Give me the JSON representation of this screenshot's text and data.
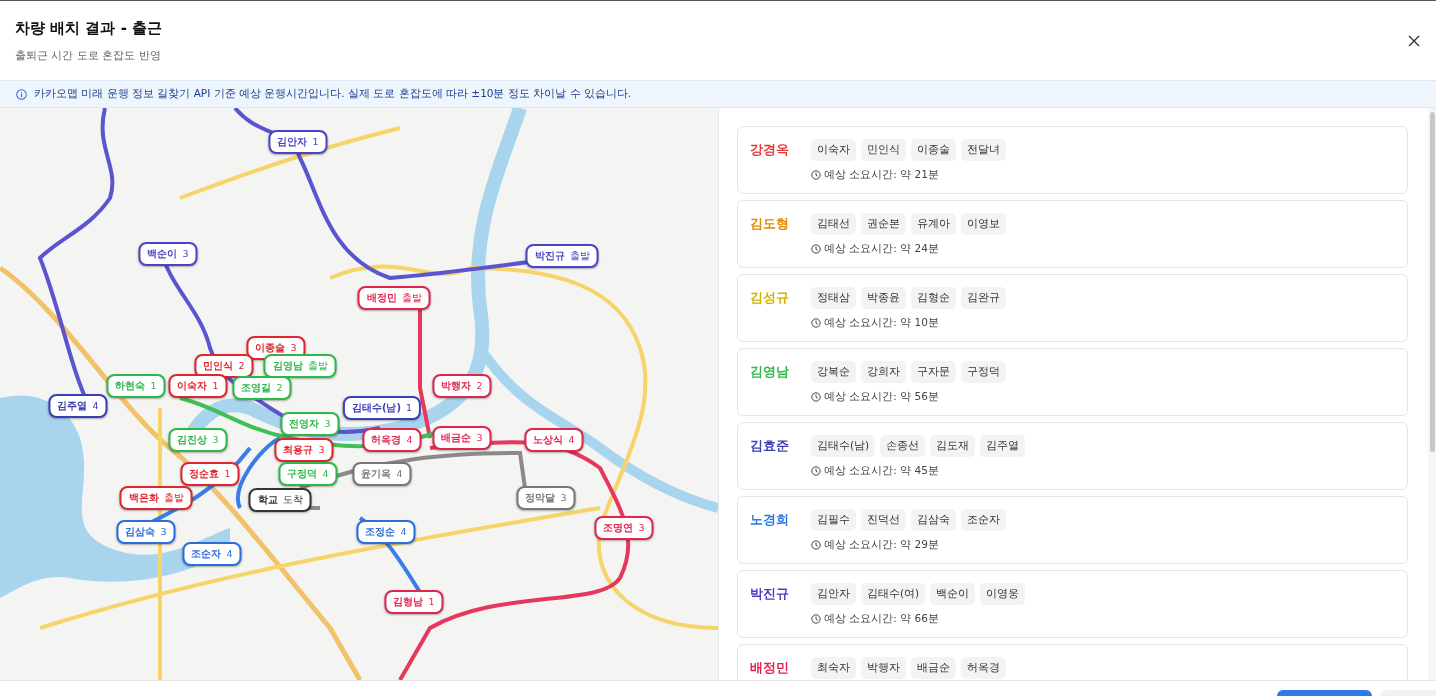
{
  "dialog": {
    "title": "차량 배치 결과 - 출근",
    "subtitle": "출퇴근 시간 도로 혼잡도 반영"
  },
  "notice": "카카오맵 미래 운행 정보 길찾기 API 기준 예상 운행시간입니다. 실제 도로 혼잡도에 따라 ±10분 정도 차이날 수 있습니다.",
  "map": {
    "markers": [
      {
        "name": "김안자",
        "tag": "1",
        "color": "#4b45c6"
      },
      {
        "name": "백순이",
        "tag": "3",
        "color": "#4b45c6"
      },
      {
        "name": "박진규",
        "tag": "출발",
        "color": "#4b45c6"
      },
      {
        "name": "배정민",
        "tag": "출발",
        "color": "#e0264f"
      },
      {
        "name": "이종술",
        "tag": "3",
        "color": "#e0262e"
      },
      {
        "name": "민인식",
        "tag": "2",
        "color": "#e0262e"
      },
      {
        "name": "김영남",
        "tag": "출발",
        "color": "#2fb84a"
      },
      {
        "name": "하현숙",
        "tag": "1",
        "color": "#2fb84a"
      },
      {
        "name": "이숙자",
        "tag": "1",
        "color": "#e0262e"
      },
      {
        "name": "조영길",
        "tag": "2",
        "color": "#2fb84a"
      },
      {
        "name": "박행자",
        "tag": "2",
        "color": "#e0264f"
      },
      {
        "name": "김주열",
        "tag": "4",
        "color": "#3b3fb5"
      },
      {
        "name": "김태수(남)",
        "tag": "1",
        "color": "#3b3fb5"
      },
      {
        "name": "전영자",
        "tag": "3",
        "color": "#2fb84a"
      },
      {
        "name": "김진상",
        "tag": "3",
        "color": "#2fb84a"
      },
      {
        "name": "허옥경",
        "tag": "4",
        "color": "#e0264f"
      },
      {
        "name": "배금순",
        "tag": "3",
        "color": "#e0264f"
      },
      {
        "name": "노상식",
        "tag": "4",
        "color": "#e0264f"
      },
      {
        "name": "최용규",
        "tag": "3",
        "color": "#e0262e"
      },
      {
        "name": "정순효",
        "tag": "1",
        "color": "#e0262e"
      },
      {
        "name": "구정덕",
        "tag": "4",
        "color": "#2fb84a"
      },
      {
        "name": "윤기옥",
        "tag": "4",
        "color": "#777777"
      },
      {
        "name": "백은화",
        "tag": "출발",
        "color": "#e0262e"
      },
      {
        "name": "학교",
        "tag": "도착",
        "color": "#333333"
      },
      {
        "name": "정막달",
        "tag": "3",
        "color": "#777777"
      },
      {
        "name": "김삼숙",
        "tag": "3",
        "color": "#2a6fdb"
      },
      {
        "name": "조정순",
        "tag": "4",
        "color": "#2a6fdb"
      },
      {
        "name": "조명연",
        "tag": "3",
        "color": "#e0264f"
      },
      {
        "name": "조순자",
        "tag": "4",
        "color": "#2a6fdb"
      },
      {
        "name": "김형남",
        "tag": "1",
        "color": "#e0264f"
      }
    ]
  },
  "drivers": [
    {
      "name": "강경옥",
      "color": "#e53935",
      "passengers": [
        "이숙자",
        "민인식",
        "이종술",
        "전달녀"
      ],
      "time": "예상 소요시간: 약 21분"
    },
    {
      "name": "김도형",
      "color": "#e08a00",
      "passengers": [
        "김태선",
        "권순본",
        "유계아",
        "이영보"
      ],
      "time": "예상 소요시간: 약 24분"
    },
    {
      "name": "김성규",
      "color": "#d4b000",
      "passengers": [
        "정태삼",
        "박종윤",
        "김형순",
        "김완규"
      ],
      "time": "예상 소요시간: 약 10분"
    },
    {
      "name": "김영남",
      "color": "#2fb84a",
      "passengers": [
        "강복순",
        "강희자",
        "구자문",
        "구정덕"
      ],
      "time": "예상 소요시간: 약 56분"
    },
    {
      "name": "김효준",
      "color": "#3b3fb5",
      "passengers": [
        "김태수(남)",
        "손종선",
        "김도재",
        "김주열"
      ],
      "time": "예상 소요시간: 약 45분"
    },
    {
      "name": "노경희",
      "color": "#2a7ae0",
      "passengers": [
        "김필수",
        "진덕선",
        "김삼숙",
        "조순자"
      ],
      "time": "예상 소요시간: 약 29분"
    },
    {
      "name": "박진규",
      "color": "#4b3cc4",
      "passengers": [
        "김안자",
        "김태수(여)",
        "백순이",
        "이영웅"
      ],
      "time": "예상 소요시간: 약 66분"
    },
    {
      "name": "배정민",
      "color": "#e0254f",
      "passengers": [
        "최숙자",
        "박행자",
        "배금순",
        "허옥경"
      ]
    }
  ]
}
